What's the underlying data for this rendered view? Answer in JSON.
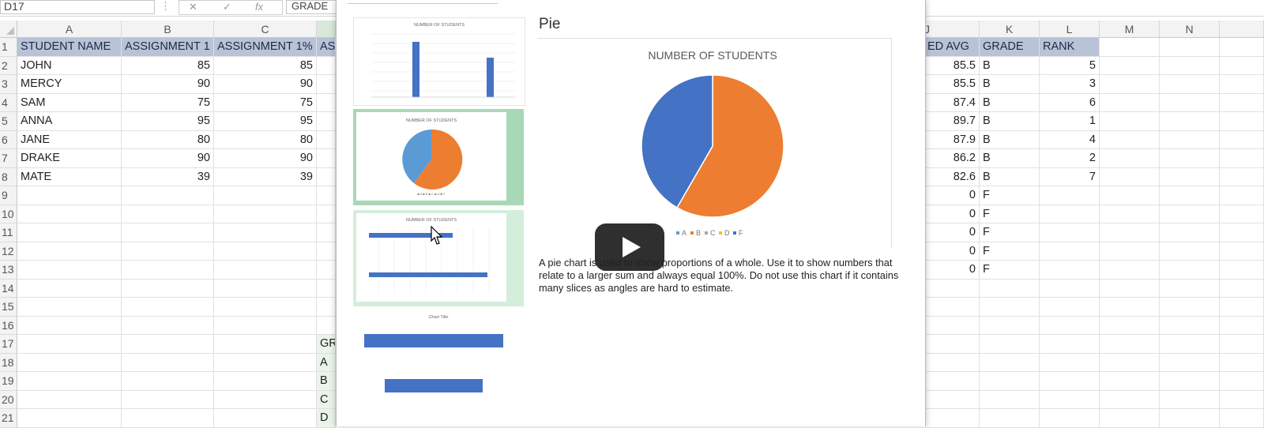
{
  "formula_bar": {
    "name_box": "D17",
    "content": "GRADE",
    "cancel_icon": "✕",
    "enter_icon": "✓",
    "fx_icon": "fx"
  },
  "columns": {
    "left": [
      "A",
      "B",
      "C"
    ],
    "right": [
      "J",
      "K",
      "L",
      "M",
      "N"
    ]
  },
  "rows": [
    "1",
    "2",
    "3",
    "4",
    "5",
    "6",
    "7",
    "8",
    "9",
    "10",
    "11",
    "12",
    "13",
    "14",
    "15",
    "16",
    "17",
    "18",
    "19",
    "20",
    "21"
  ],
  "sheet": {
    "header_left": [
      "STUDENT NAME",
      "ASSIGNMENT 1",
      "ASSIGNMENT 1%",
      "ASS"
    ],
    "header_right": [
      "ED AVG",
      "GRADE",
      "RANK"
    ],
    "students": [
      {
        "name": "JOHN",
        "a1": "85",
        "a1p": "85",
        "avg": "85.5",
        "grade": "B",
        "rank": "5"
      },
      {
        "name": "MERCY",
        "a1": "90",
        "a1p": "90",
        "avg": "85.5",
        "grade": "B",
        "rank": "3"
      },
      {
        "name": "SAM",
        "a1": "75",
        "a1p": "75",
        "avg": "87.4",
        "grade": "B",
        "rank": "6"
      },
      {
        "name": "ANNA",
        "a1": "95",
        "a1p": "95",
        "avg": "89.7",
        "grade": "B",
        "rank": "1"
      },
      {
        "name": "JANE",
        "a1": "80",
        "a1p": "80",
        "avg": "87.9",
        "grade": "B",
        "rank": "4"
      },
      {
        "name": "DRAKE",
        "a1": "90",
        "a1p": "90",
        "avg": "86.2",
        "grade": "B",
        "rank": "2"
      },
      {
        "name": "MATE",
        "a1": "39",
        "a1p": "39",
        "avg": "82.6",
        "grade": "B",
        "rank": "7"
      }
    ],
    "empty_rows": [
      {
        "avg": "0",
        "grade": "F"
      },
      {
        "avg": "0",
        "grade": "F"
      },
      {
        "avg": "0",
        "grade": "F"
      },
      {
        "avg": "0",
        "grade": "F"
      },
      {
        "avg": "0",
        "grade": "F"
      }
    ],
    "d_column": [
      "GR",
      "A",
      "B",
      "C",
      "D"
    ]
  },
  "dialog": {
    "preview_title": "Pie",
    "description": "A pie chart is used to show proportions of a whole. Use it to show numbers that relate to a larger sum and always equal 100%. Do not use this chart if it contains many slices as angles are hard to estimate.",
    "thumbnails": [
      {
        "title": "NUMBER OF STUDENTS",
        "kind": "column"
      },
      {
        "title": "NUMBER OF STUDENTS",
        "kind": "pie",
        "selected": true
      },
      {
        "title": "NUMBER OF STUDENTS",
        "kind": "bar",
        "hover": true
      },
      {
        "title": "Chart Title",
        "kind": "bar"
      }
    ]
  },
  "chart_data": {
    "type": "pie",
    "title": "NUMBER OF STUDENTS",
    "categories": [
      "A",
      "B",
      "C",
      "D",
      "F"
    ],
    "values": [
      0,
      7,
      0,
      0,
      5
    ],
    "colors": [
      "#5b9bd5",
      "#ed7d31",
      "#a5a5a5",
      "#ffc000",
      "#4472c4"
    ],
    "legend": "bottom"
  },
  "player": {
    "play_icon": "play-icon"
  }
}
